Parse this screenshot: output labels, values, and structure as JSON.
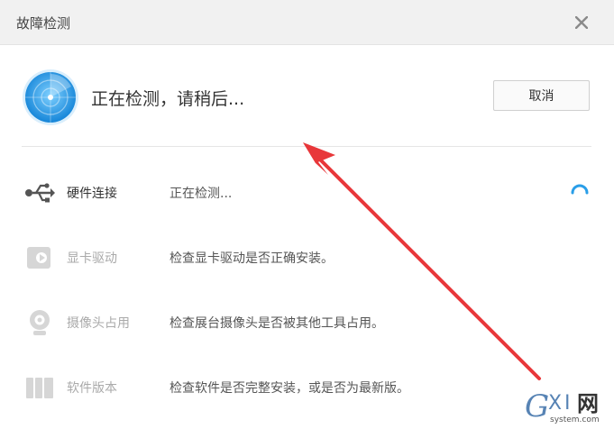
{
  "window": {
    "title": "故障检测"
  },
  "status": {
    "text": "正在检测，请稍后...",
    "cancel_label": "取消"
  },
  "checks": [
    {
      "name": "硬件连接",
      "description": "正在检测...",
      "icon": "usb-icon",
      "state": "checking"
    },
    {
      "name": "显卡驱动",
      "description": "检查显卡驱动是否正确安装。",
      "icon": "graphics-card-icon",
      "state": "pending"
    },
    {
      "name": "摄像头占用",
      "description": "检查展台摄像头是否被其他工具占用。",
      "icon": "webcam-icon",
      "state": "pending"
    },
    {
      "name": "软件版本",
      "description": "检查软件是否完整安装，或是否为最新版。",
      "icon": "software-version-icon",
      "state": "pending"
    }
  ],
  "watermark": {
    "brand": "GXI网",
    "domain": "system.com"
  },
  "colors": {
    "accent": "#2a9ee8",
    "arrow": "#e8373a"
  }
}
